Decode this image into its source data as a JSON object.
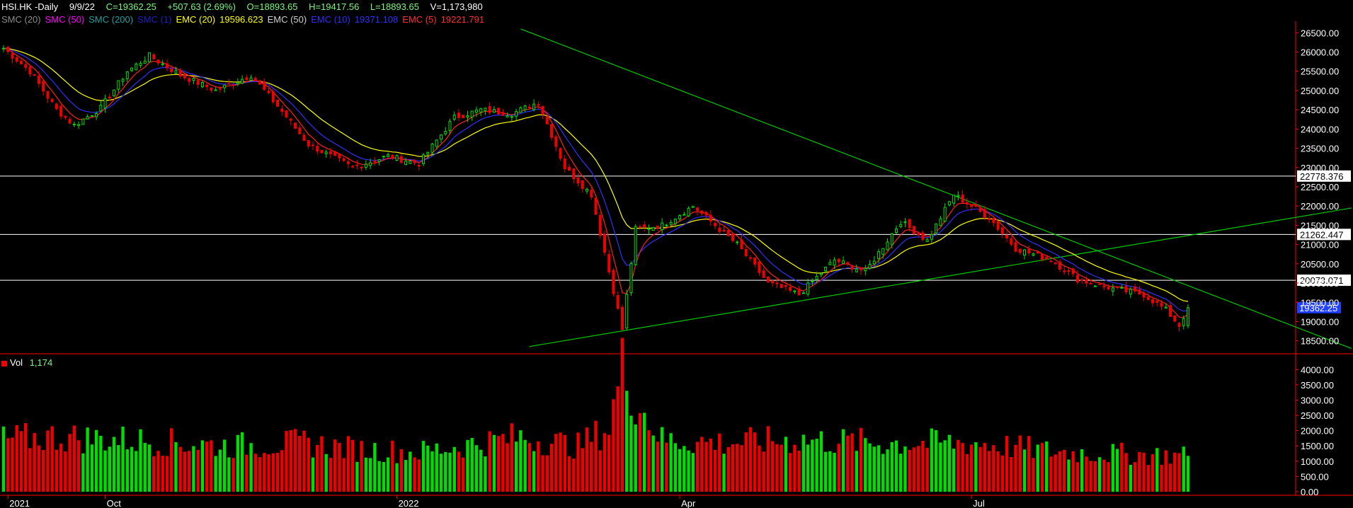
{
  "header": {
    "symbol": "HSI.HK -Daily",
    "date": "9/9/22",
    "close": "C=19362.25",
    "change": "+507.63 (2.69%)",
    "open": "O=18893.65",
    "high": "H=19417.56",
    "low": "L=18893.65",
    "volume": "V=1,173,980"
  },
  "indicators": [
    {
      "label": "SMC (20)",
      "color": "#8c8c8c"
    },
    {
      "label": "SMC (50)",
      "color": "#ff00ff"
    },
    {
      "label": "SMC (200)",
      "color": "#20a0a0"
    },
    {
      "label": "SMC (1)",
      "color": "#2020c0"
    },
    {
      "label": "EMC (20)",
      "color": "#ffff00"
    },
    {
      "label": "19596.623",
      "color": "#ffff00"
    },
    {
      "label": "EMC (50)",
      "color": "#d0d0d0"
    },
    {
      "label": "EMC (10)",
      "color": "#3030ff"
    },
    {
      "label": "19371.108",
      "color": "#3030ff"
    },
    {
      "label": "EMC (5)",
      "color": "#ff3030"
    },
    {
      "label": "19221.791",
      "color": "#ff3030"
    }
  ],
  "volume_header": {
    "label": "Vol",
    "value": "1,174"
  },
  "colors": {
    "background": "#000000",
    "up": "#00dd00",
    "down": "#ee0000",
    "axis": "#ff0000",
    "trendline": "#00cc00",
    "ema20": "#ffff00",
    "ema10": "#3030ff",
    "ema5": "#ff2020",
    "hline": "#ffffff",
    "price_badge": "#1f3fff"
  },
  "chart_data": [
    {
      "type": "candlestick",
      "title": "HSI.HK -Daily",
      "ylim": [
        18200,
        26800
      ],
      "y_ticks": [
        "26500.00",
        "26000.00",
        "25500.00",
        "25000.00",
        "24500.00",
        "24000.00",
        "23500.00",
        "23000.00",
        "22500.00",
        "22000.00",
        "21500.00",
        "21000.00",
        "20500.00",
        "20000.00",
        "19500.00",
        "19000.00",
        "18500.00"
      ],
      "x_labels": [
        {
          "label": "2021",
          "date": "2021-09-01"
        },
        {
          "label": "Oct",
          "date": "2021-10-01"
        },
        {
          "label": "2022",
          "date": "2022-01-03"
        },
        {
          "label": "Apr",
          "date": "2022-04-01"
        },
        {
          "label": "Jul",
          "date": "2022-07-04"
        }
      ],
      "horizontal_levels": [
        {
          "value": 22778.376,
          "label": "22778.376"
        },
        {
          "value": 21262.447,
          "label": "21262.447"
        },
        {
          "value": 20073.071,
          "label": "20073.071"
        }
      ],
      "last_price": {
        "value": 19362.25,
        "label": "19362.25"
      },
      "trendlines": [
        {
          "from": {
            "date": "2022-02-10",
            "value": 26600
          },
          "to": {
            "date": "2022-10-31",
            "value": 18300
          }
        },
        {
          "from": {
            "date": "2022-02-14",
            "value": 18350
          },
          "to": {
            "date": "2022-10-31",
            "value": 21950
          }
        }
      ],
      "price_anchors": [
        [
          "2021-08-31",
          26100
        ],
        [
          "2021-09-08",
          25500
        ],
        [
          "2021-09-16",
          24500
        ],
        [
          "2021-09-22",
          24100
        ],
        [
          "2021-09-30",
          24550
        ],
        [
          "2021-10-08",
          25500
        ],
        [
          "2021-10-15",
          25900
        ],
        [
          "2021-10-26",
          25400
        ],
        [
          "2021-11-05",
          25000
        ],
        [
          "2021-11-17",
          25400
        ],
        [
          "2021-11-25",
          24600
        ],
        [
          "2021-12-06",
          23600
        ],
        [
          "2021-12-20",
          23000
        ],
        [
          "2021-12-30",
          23300
        ],
        [
          "2022-01-10",
          23100
        ],
        [
          "2022-01-20",
          24300
        ],
        [
          "2022-01-28",
          24500
        ],
        [
          "2022-02-08",
          24400
        ],
        [
          "2022-02-16",
          24700
        ],
        [
          "2022-02-24",
          23000
        ],
        [
          "2022-03-04",
          22300
        ],
        [
          "2022-03-15",
          18800
        ],
        [
          "2022-03-18",
          21400
        ],
        [
          "2022-03-28",
          21500
        ],
        [
          "2022-04-06",
          22000
        ],
        [
          "2022-04-20",
          21000
        ],
        [
          "2022-04-29",
          20000
        ],
        [
          "2022-05-10",
          19700
        ],
        [
          "2022-05-20",
          20600
        ],
        [
          "2022-05-31",
          20300
        ],
        [
          "2022-06-10",
          21600
        ],
        [
          "2022-06-20",
          21100
        ],
        [
          "2022-06-28",
          22300
        ],
        [
          "2022-07-08",
          21700
        ],
        [
          "2022-07-18",
          20900
        ],
        [
          "2022-07-28",
          20600
        ],
        [
          "2022-08-05",
          20100
        ],
        [
          "2022-08-15",
          19900
        ],
        [
          "2022-08-26",
          19700
        ],
        [
          "2022-09-02",
          19300
        ],
        [
          "2022-09-07",
          18900
        ],
        [
          "2022-09-09",
          19362.25
        ]
      ]
    },
    {
      "type": "bar",
      "title": "Vol",
      "value_label": "1,174",
      "ylim": [
        0,
        4400
      ],
      "y_ticks": [
        "4000.00",
        "3500.00",
        "3000.00",
        "2500.00",
        "2000.00",
        "1500.00",
        "1000.00",
        "500.00",
        "0.00"
      ],
      "volume_anchors": [
        [
          "2021-08-31",
          1700
        ],
        [
          "2021-09-15",
          1800
        ],
        [
          "2021-10-08",
          1700
        ],
        [
          "2021-11-10",
          1500
        ],
        [
          "2021-12-03",
          1600
        ],
        [
          "2021-12-20",
          1400
        ],
        [
          "2022-01-10",
          1300
        ],
        [
          "2022-02-10",
          1800
        ],
        [
          "2022-03-01",
          1500
        ],
        [
          "2022-03-10",
          2100
        ],
        [
          "2022-03-15",
          4100
        ],
        [
          "2022-03-20",
          3000
        ],
        [
          "2022-03-28",
          1700
        ],
        [
          "2022-04-15",
          1600
        ],
        [
          "2022-05-10",
          1700
        ],
        [
          "2022-06-05",
          1600
        ],
        [
          "2022-07-05",
          1600
        ],
        [
          "2022-08-01",
          1300
        ],
        [
          "2022-09-09",
          1174
        ]
      ]
    }
  ]
}
